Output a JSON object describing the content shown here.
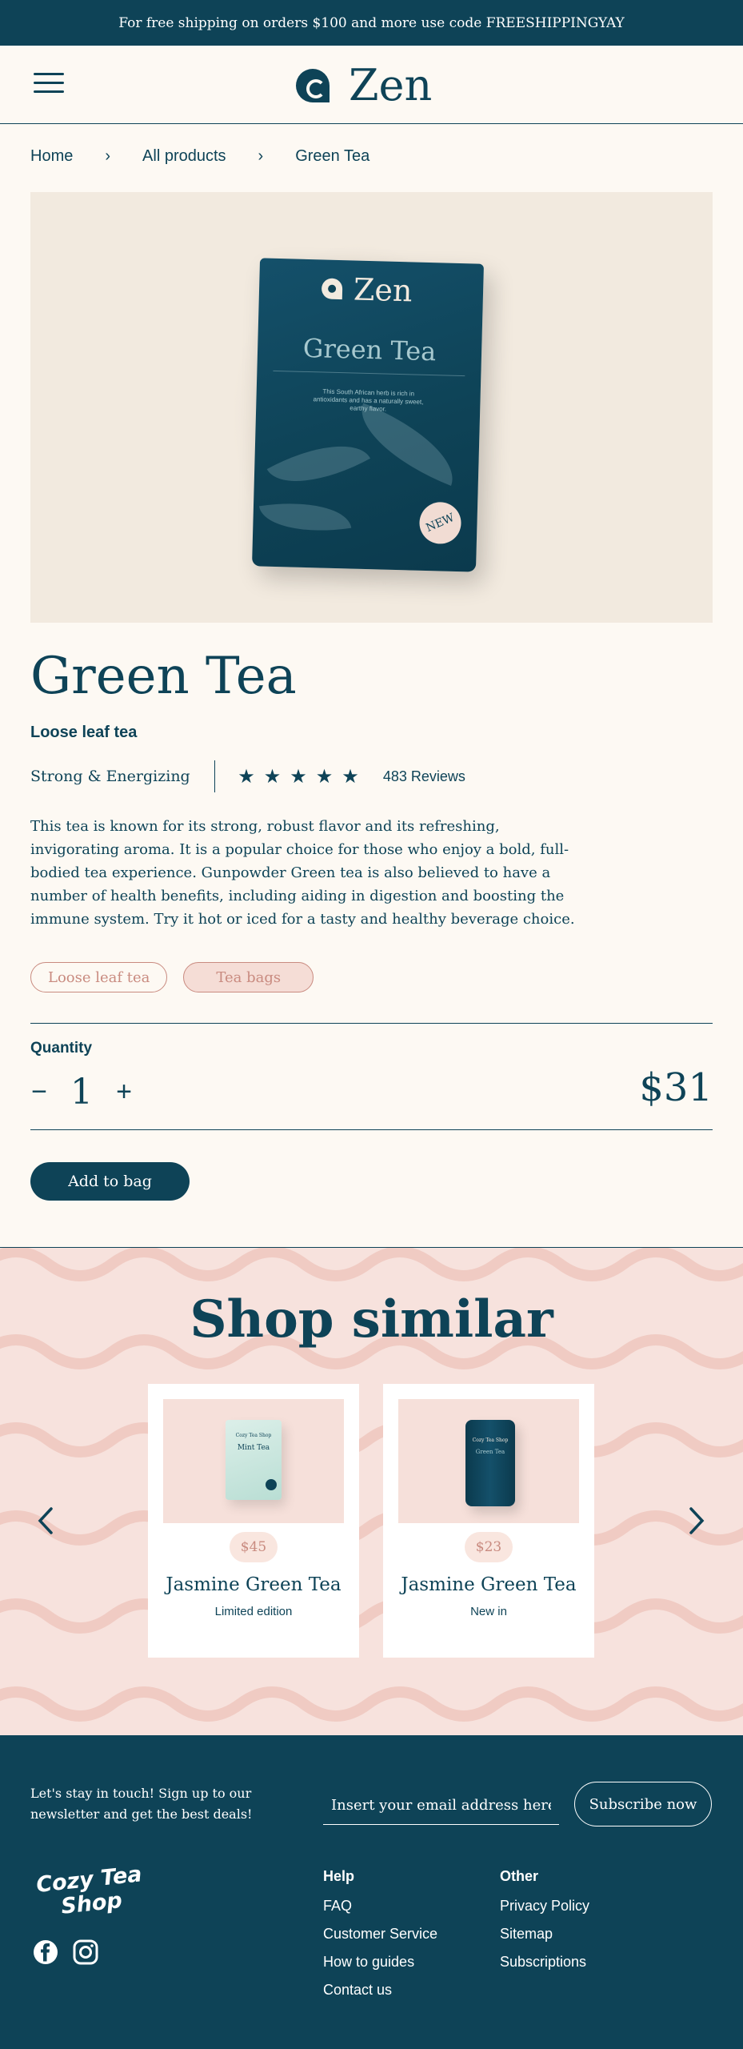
{
  "promo": {
    "text": "For free shipping on orders $100 and more use code FREESHIPPINGYAY"
  },
  "header": {
    "logo_text": "Zen",
    "menu_icon": "hamburger-icon"
  },
  "breadcrumb": [
    "Home",
    "All products",
    "Green Tea"
  ],
  "hero": {
    "pouch_logo": "Zen",
    "pouch_name": "Green Tea",
    "pouch_desc": "This South African herb is rich in antioxidants and has a naturally sweet, earthy flavor.",
    "badge": "NEW"
  },
  "product": {
    "title": "Green Tea",
    "subtitle": "Loose leaf tea",
    "profile": "Strong & Energizing",
    "rating": 5,
    "reviews": "483 Reviews",
    "description": "This tea is known for its strong, robust flavor and its refreshing, invigorating aroma. It is a popular choice for those who enjoy a bold, full-bodied tea experience. Gunpowder Green tea is also believed to have a number of health benefits, including aiding in digestion and boosting the immune system. Try it hot or iced for a tasty and healthy beverage choice.",
    "variants": [
      "Loose leaf tea",
      "Tea bags"
    ],
    "selected_variant": "Tea bags",
    "quantity_label": "Quantity",
    "quantity": "1",
    "minus": "−",
    "plus": "+",
    "price": "$31",
    "add_to_bag": "Add to bag"
  },
  "similar": {
    "title": "Shop similar",
    "prev_icon": "chevron-left-icon",
    "next_icon": "chevron-right-icon",
    "cards": [
      {
        "price": "$45",
        "name": "Jasmine Green Tea",
        "tag": "Limited edition",
        "pack_brand": "Cozy Tea Shop",
        "pack_name": "Mint Tea"
      },
      {
        "price": "$23",
        "name": "Jasmine Green Tea",
        "tag": "New in",
        "pack_brand": "Cozy Tea Shop",
        "pack_name": "Green Tea"
      }
    ]
  },
  "footer": {
    "newsletter": "Let's stay in touch! Sign up to our newsletter and get the best deals!",
    "email_placeholder": "Insert your email address here",
    "subscribe": "Subscribe now",
    "brand": "Cozy Tea Shop",
    "socials": [
      "facebook-icon",
      "instagram-icon"
    ],
    "help_title": "Help",
    "help_links": [
      "FAQ",
      "Customer Service",
      "How to guides",
      "Contact us"
    ],
    "other_title": "Other",
    "other_links": [
      "Privacy Policy",
      "Sitemap",
      "Subscriptions"
    ]
  },
  "colors": {
    "primary": "#0e4357",
    "background": "#fdf9f3",
    "accent_pink": "#f7e2dd",
    "accent_text": "#c98b80"
  }
}
